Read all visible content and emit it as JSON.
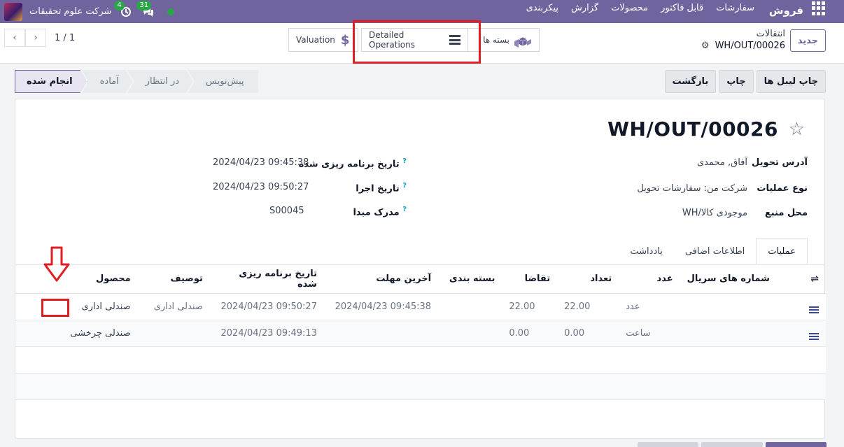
{
  "navbar": {
    "app_name": "فروش",
    "menu": [
      "سفارشات",
      "قابل فاکتور",
      "محصولات",
      "گزارش",
      "پیکربندی"
    ],
    "company": "شرکت علوم تحقیقات",
    "activity_count": "4",
    "messages_count": "31",
    "brand_color": "#71639e"
  },
  "breadcrumb": {
    "root": "انتقالات",
    "current": "WH/OUT/00026"
  },
  "buttons": {
    "new": "جدید",
    "print_labels": "چاپ لیبل ها",
    "print": "چاپ",
    "return": "بازگشت"
  },
  "pager": {
    "value": "1 / 1"
  },
  "smart_buttons": {
    "valuation": "Valuation",
    "detailed_operations": "Detailed Operations",
    "packages": "بسته ها"
  },
  "stages": [
    "انجام شده",
    "آماده",
    "در انتظار",
    "پیش‌نویس"
  ],
  "record": {
    "title": "WH/OUT/00026",
    "delivery_address_label": "آدرس تحویل",
    "delivery_address": "آفاق, محمدی",
    "operation_type_label": "نوع عملیات",
    "operation_type": "شرکت من: سفارشات تحویل",
    "source_location_label": "محل منبع",
    "source_location": "WH/موجودی کالا",
    "scheduled_date_label": "تاریخ برنامه ریزی شده",
    "scheduled_date": "2024/04/23 09:45:38",
    "effective_date_label": "تاریخ اجرا",
    "effective_date": "2024/04/23 09:50:27",
    "source_document_label": "مدرک مبدا",
    "source_document": "S00045"
  },
  "tabs": [
    "عملیات",
    "اطلاعات اضافی",
    "یادداشت"
  ],
  "table": {
    "columns": [
      "محصول",
      "توصیف",
      "تاریخ برنامه ریزی شده",
      "آخرین مهلت",
      "بسته بندی",
      "تقاضا",
      "تعداد",
      "عدد",
      "شماره های سریال"
    ],
    "rows": [
      {
        "product": "صندلی اداری",
        "description": "صندلی اداری",
        "scheduled": "2024/04/23 09:50:27",
        "deadline": "2024/04/23 09:45:38",
        "packaging": "",
        "demand": "22.00",
        "quantity": "22.00",
        "uom": "عدد"
      },
      {
        "product": "صندلی چرخشی",
        "description": "",
        "scheduled": "2024/04/23 09:49:13",
        "deadline": "",
        "packaging": "",
        "demand": "0.00",
        "quantity": "0.00",
        "uom": "ساعت"
      }
    ]
  },
  "annotations": {
    "highlight_color": "#e11d24"
  }
}
